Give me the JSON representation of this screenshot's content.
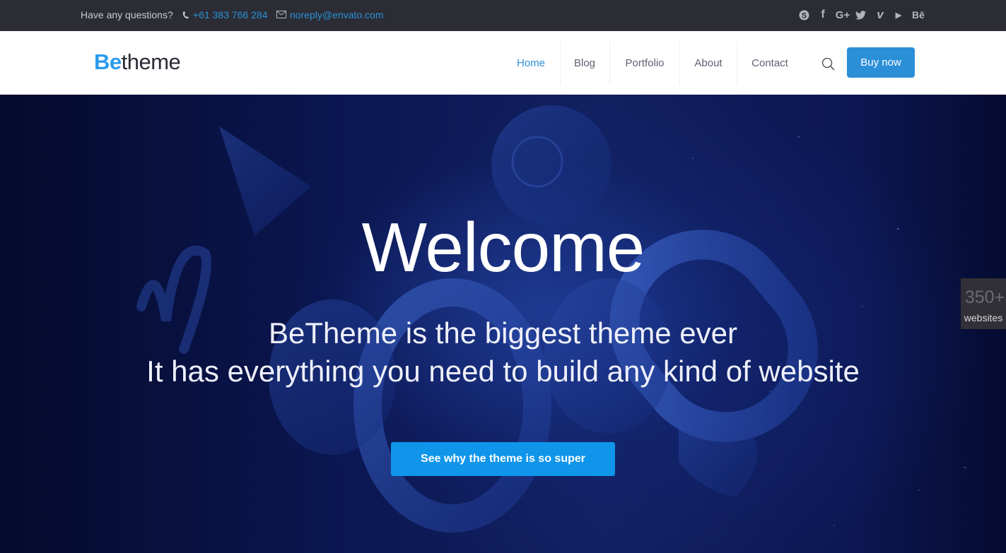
{
  "topbar": {
    "question": "Have any questions?",
    "phone_icon": "phone-icon",
    "phone": "+61 383 766 284",
    "mail_icon": "envelope-icon",
    "email": "noreply@envato.com",
    "social": [
      {
        "name": "skype",
        "glyph": "S"
      },
      {
        "name": "facebook",
        "glyph": "f"
      },
      {
        "name": "google-plus",
        "glyph": "G+"
      },
      {
        "name": "twitter",
        "glyph": "🐦"
      },
      {
        "name": "vimeo",
        "glyph": "v"
      },
      {
        "name": "youtube",
        "glyph": "▶"
      },
      {
        "name": "behance",
        "glyph": "Bē"
      }
    ]
  },
  "header": {
    "logo": {
      "be": "Be",
      "theme": "theme"
    },
    "nav": [
      {
        "label": "Home",
        "active": true
      },
      {
        "label": "Blog",
        "active": false
      },
      {
        "label": "Portfolio",
        "active": false
      },
      {
        "label": "About",
        "active": false
      },
      {
        "label": "Contact",
        "active": false
      }
    ],
    "search_icon": "search-icon",
    "buy_label": "Buy now"
  },
  "hero": {
    "title": "Welcome",
    "subtitle_line1": "BeTheme is the biggest theme ever",
    "subtitle_line2": "It has everything you need to build any kind of website",
    "cta_label": "See why the theme is so super"
  },
  "badge": {
    "count": "350+",
    "label": "websites"
  },
  "colors": {
    "accent": "#2b8fd8",
    "cta": "#0f95ea",
    "topbar_bg": "#2c2c35",
    "link": "#2991d6"
  }
}
